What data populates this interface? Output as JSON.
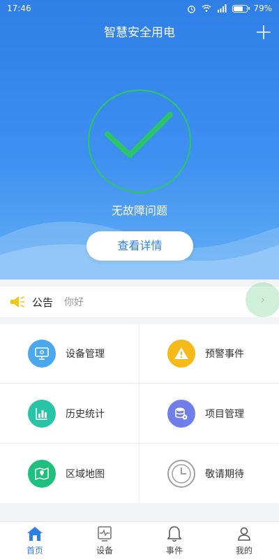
{
  "status_bar": {
    "time": "17:46",
    "battery": "79%",
    "battery_level": 0.79
  },
  "header": {
    "title": "智慧安全用电"
  },
  "status": {
    "text": "无故障问题",
    "button_label": "查看详情"
  },
  "notice": {
    "title": "公告",
    "message": "你好"
  },
  "menu": [
    {
      "label": "设备管理",
      "icon": "device-monitor-icon",
      "color": "#4aa8ee"
    },
    {
      "label": "预警事件",
      "icon": "warning-icon",
      "color": "#f5b918"
    },
    {
      "label": "历史统计",
      "icon": "bar-chart-icon",
      "color": "#27c4a8"
    },
    {
      "label": "项目管理",
      "icon": "database-gear-icon",
      "color": "#6f7ee8"
    },
    {
      "label": "区域地图",
      "icon": "map-pin-icon",
      "color": "#1fbf7e"
    },
    {
      "label": "敬请期待",
      "icon": "clock-icon",
      "color": "#a0a0a0"
    }
  ],
  "nav": [
    {
      "label": "首页",
      "icon": "home-icon",
      "active": true
    },
    {
      "label": "设备",
      "icon": "device-pulse-icon",
      "active": false
    },
    {
      "label": "事件",
      "icon": "bell-icon",
      "active": false
    },
    {
      "label": "我的",
      "icon": "user-icon",
      "active": false
    }
  ],
  "colors": {
    "primary": "#2f7fe6",
    "ok_green": "#2cc46b"
  }
}
